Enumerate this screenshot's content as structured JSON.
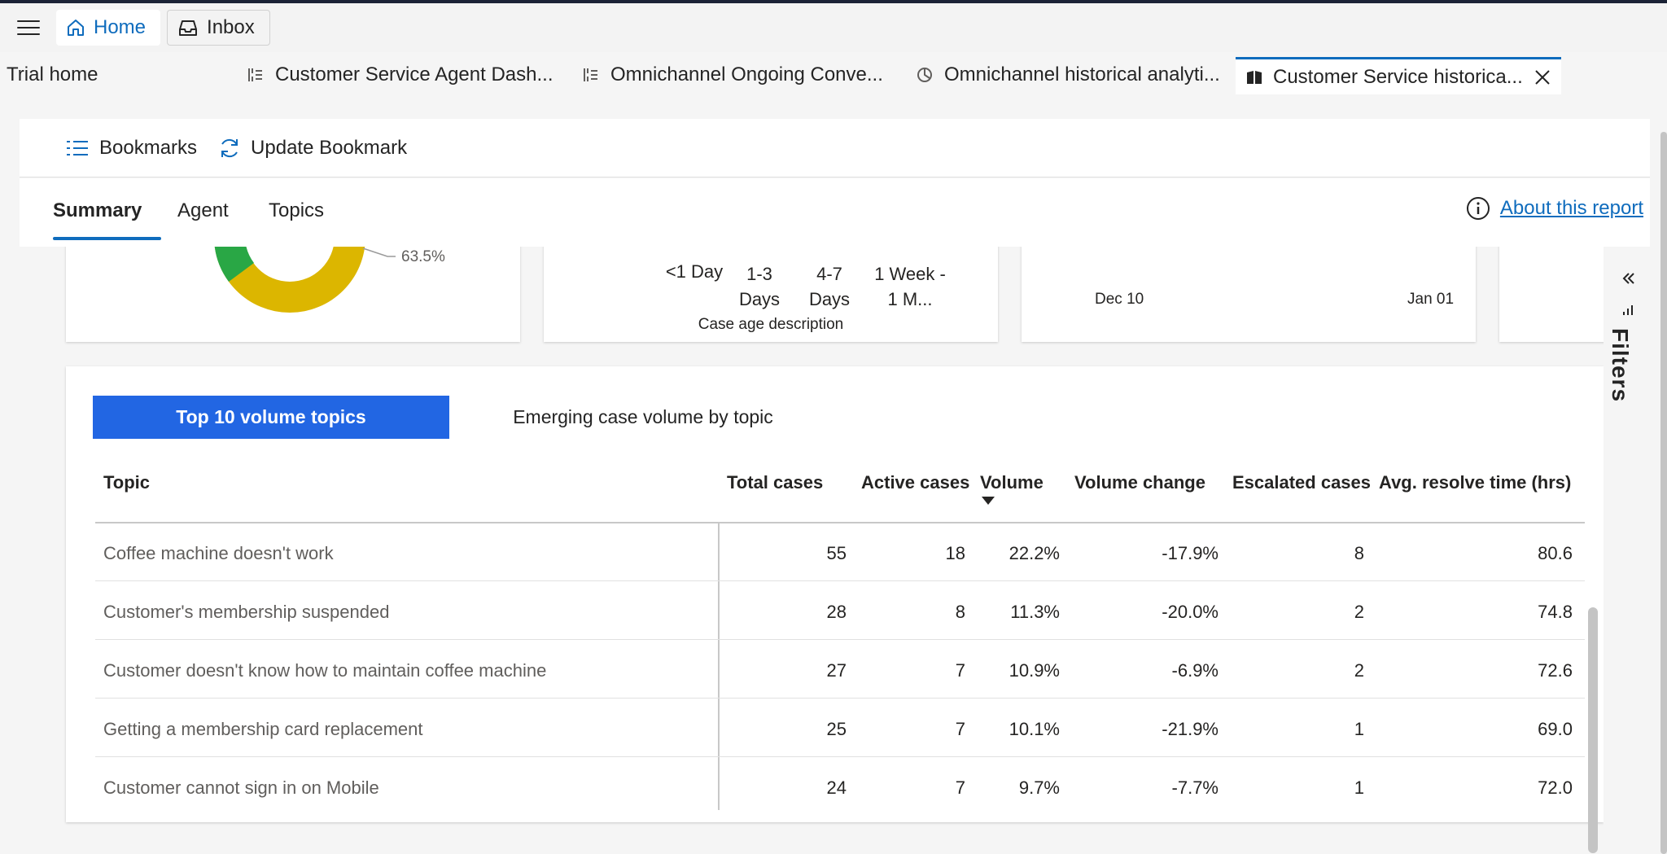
{
  "topbar": {
    "home_label": "Home",
    "inbox_label": "Inbox"
  },
  "session_tabs": [
    {
      "label": "Trial home"
    },
    {
      "label": "Customer Service Agent Dash..."
    },
    {
      "label": "Omnichannel Ongoing Conve..."
    },
    {
      "label": "Omnichannel historical analyti..."
    },
    {
      "label": "Customer Service historica..."
    }
  ],
  "command_bar": {
    "bookmarks_label": "Bookmarks",
    "update_bookmark_label": "Update Bookmark"
  },
  "report_tabs": {
    "summary": "Summary",
    "agent": "Agent",
    "topics": "Topics",
    "about_link": "About this report"
  },
  "cards": {
    "donut_label": "63.5%",
    "age_categories": [
      "<1 Day",
      "1-3 Days",
      "4-7 Days",
      "1 Week - 1 M..."
    ],
    "age_axis_title": "Case age description",
    "trend_x_start": "Dec 10",
    "trend_x_end": "Jan 01",
    "colors": {
      "donut_yellow": "#dcb600",
      "donut_green": "#29a745"
    }
  },
  "filters_pane": {
    "label": "Filters"
  },
  "topics_table": {
    "tab_active": "Top 10 volume topics",
    "tab_inactive": "Emerging case volume by topic",
    "columns": [
      "Topic",
      "Total cases",
      "Active cases",
      "Volume",
      "Volume change",
      "Escalated cases",
      "Avg. resolve time (hrs)"
    ],
    "rows": [
      {
        "topic": "Coffee machine doesn't work",
        "total": "55",
        "active": "18",
        "volume": "22.2%",
        "change": "-17.9%",
        "escalated": "8",
        "resolve": "80.6"
      },
      {
        "topic": "Customer's membership suspended",
        "total": "28",
        "active": "8",
        "volume": "11.3%",
        "change": "-20.0%",
        "escalated": "2",
        "resolve": "74.8"
      },
      {
        "topic": "Customer doesn't know how to maintain coffee machine",
        "total": "27",
        "active": "7",
        "volume": "10.9%",
        "change": "-6.9%",
        "escalated": "2",
        "resolve": "72.6"
      },
      {
        "topic": "Getting a membership card replacement",
        "total": "25",
        "active": "7",
        "volume": "10.1%",
        "change": "-21.9%",
        "escalated": "1",
        "resolve": "69.0"
      },
      {
        "topic": "Customer cannot sign in on Mobile",
        "total": "24",
        "active": "7",
        "volume": "9.7%",
        "change": "-7.7%",
        "escalated": "1",
        "resolve": "72.0"
      }
    ]
  },
  "colors": {
    "accent": "#0f6cbd",
    "active_tab_button": "#2266e3"
  }
}
